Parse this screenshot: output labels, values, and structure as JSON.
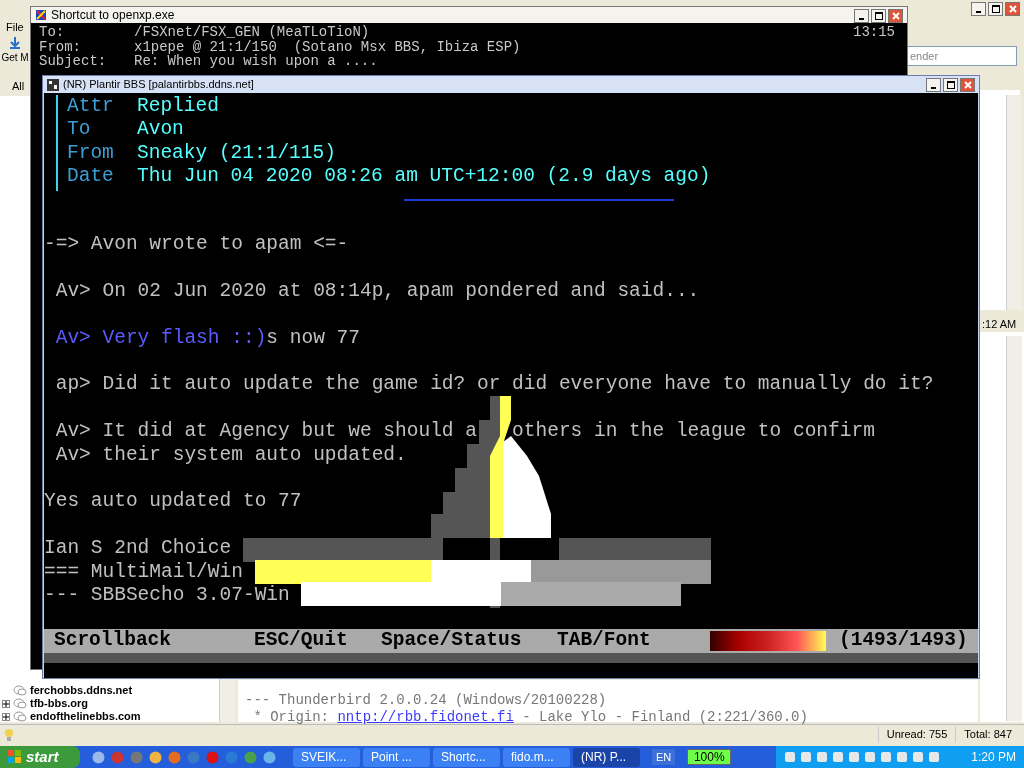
{
  "thunderbird": {
    "menu": [
      "File"
    ],
    "toolbar_button": "Get M",
    "view_filter": "All",
    "search": {
      "placeholder": "ender"
    },
    "message_time": ":12 AM",
    "folders": [
      {
        "label": "ferchobbs.ddns.net",
        "expandable": false
      },
      {
        "label": "tfb-bbs.org",
        "expandable": true
      },
      {
        "label": "endofthelinebbs.com",
        "expandable": true
      }
    ],
    "message_lines": [
      [
        {
          "text": "--- Thunderbird 2.0.0.24 (Windows/20100228)",
          "kind": "text"
        }
      ],
      [
        {
          "text": " * Origin: ",
          "kind": "text"
        },
        {
          "text": "nntp://rbb.fidonet.fi",
          "kind": "link"
        },
        {
          "text": " - Lake Ylo - Finland (2:221/360.0)",
          "kind": "text"
        }
      ]
    ],
    "status_bar": [
      {
        "text": "Unread: 755"
      },
      {
        "text": "Total: 847"
      }
    ]
  },
  "openxp": {
    "title": "Shortcut to openxp.exe",
    "time": "13:15",
    "header": [
      {
        "label": "To:",
        "value": "/FSXnet/FSX_GEN (MeaTLoTioN)"
      },
      {
        "label": "From:",
        "value": "x1pepe @ 21:1/150  (Sotano Msx BBS, Ibiza ESP)"
      },
      {
        "label": "Subject:",
        "value": "Re: When you wish upon a ...."
      }
    ]
  },
  "plantir": {
    "title": "(NR) Plantir BBS [palantirbbs.ddns.net]",
    "header": [
      {
        "label": "Attr",
        "value": "Replied"
      },
      {
        "label": "To",
        "value": "Avon"
      },
      {
        "label": "From",
        "value": "Sneaky (21:1/115)"
      },
      {
        "label": "Date",
        "value": "Thu Jun 04 2020 08:26 am UTC+12:00 (2.9 days ago)"
      }
    ],
    "lines": [
      {
        "blank_before": true,
        "segments": [
          {
            "text": "-=> Avon wrote to apam <=-",
            "kind": "normal"
          }
        ]
      },
      {
        "blank_before": true,
        "segments": [
          {
            "text": " Av> On 02 Jun 2020 at 08:14p, apam pondered and said...",
            "kind": "normal"
          }
        ]
      },
      {
        "blank_before": true,
        "segments": [
          {
            "text": " Av> Very flash ::)",
            "kind": "quote"
          },
          {
            "text": "s now 77",
            "kind": "normal"
          }
        ]
      },
      {
        "blank_before": true,
        "segments": [
          {
            "text": " ap> Did it auto update the game id? or did everyone have to manually do it?",
            "kind": "normal"
          }
        ]
      },
      {
        "blank_before": true,
        "segments": [
          {
            "text": " Av> It did at Agency but we should a",
            "kind": "normal"
          },
          {
            "text": "others in the league to confirm",
            "kind": "after_sail"
          }
        ]
      },
      {
        "blank_before": false,
        "segments": [
          {
            "text": " Av> their system auto updated.",
            "kind": "normal"
          }
        ]
      },
      {
        "blank_before": true,
        "segments": [
          {
            "text": "Yes auto updated to 77",
            "kind": "normal"
          }
        ]
      },
      {
        "blank_before": true,
        "segments": [
          {
            "text": "Ian S 2nd Choice",
            "kind": "normal"
          }
        ]
      },
      {
        "blank_before": false,
        "segments": [
          {
            "text": "=== MultiMail/Win",
            "kind": "normal"
          }
        ]
      },
      {
        "blank_before": false,
        "segments": [
          {
            "text": "--- SBBSecho 3.07-Win",
            "kind": "normal"
          }
        ]
      }
    ],
    "status_bar": {
      "items": [
        "Scrollback",
        "ESC/Quit",
        "Space/Status",
        "TAB/Font"
      ],
      "counter": "(1493/1493)"
    }
  },
  "taskbar": {
    "start": "start",
    "tasks": [
      {
        "label": "SVEIK...",
        "selected": false
      },
      {
        "label": "Point ...",
        "selected": false
      },
      {
        "label": "Shortc...",
        "selected": false
      },
      {
        "label": "fido.m...",
        "selected": false
      },
      {
        "label": "(NR) P...",
        "selected": true
      }
    ],
    "language": "EN",
    "battery": "100%",
    "clock": "1:20 PM"
  }
}
